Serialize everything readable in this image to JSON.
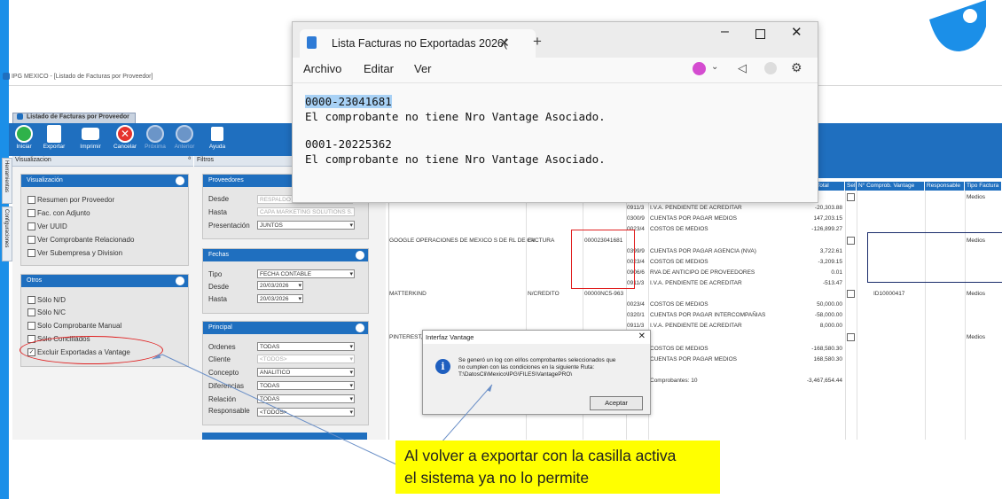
{
  "window_title": "IPG MEXICO - [Listado de Facturas por Proveedor]",
  "app_tab": "Listado de Facturas por Proveedor",
  "toolbar": {
    "iniciar": "Iniciar",
    "exportar": "Exportar",
    "imprimir": "Imprimir",
    "cancelar": "Cancelar",
    "proxima": "Próxima",
    "anterior": "Anterior",
    "ayuda": "Ayuda"
  },
  "subheader": {
    "visualizacion": "Visualizacion",
    "pin": "ª",
    "filtros": "Filtros"
  },
  "side_tabs": {
    "herramientas": "Herramientas",
    "configuraciones": "Configuraciones"
  },
  "visualizacion_panel": {
    "title": "Visualización",
    "items": [
      {
        "label": "Resumen por Proveedor",
        "checked": false
      },
      {
        "label": "Fac. con Adjunto",
        "checked": false
      },
      {
        "label": "Ver UUID",
        "checked": false
      },
      {
        "label": "Ver Comprobante Relacionado",
        "checked": false
      },
      {
        "label": "Ver Subempresa y Division",
        "checked": false
      }
    ]
  },
  "otros_panel": {
    "title": "Otros",
    "items": [
      {
        "label": "Sólo N/D",
        "checked": false
      },
      {
        "label": "Sólo N/C",
        "checked": false
      },
      {
        "label": "Solo Comprobante Manual",
        "checked": false
      },
      {
        "label": "Sólo Conciliados",
        "checked": false
      },
      {
        "label": "Excluir Exportadas a Vantage",
        "checked": true,
        "mark": "✓"
      }
    ]
  },
  "proveedores_panel": {
    "title": "Proveedores",
    "desde_label": "Desde",
    "desde_value": "RESPALDO F",
    "hasta_label": "Hasta",
    "hasta_value": "CAPA MARKETING SOLUTIONS S.",
    "presentacion_label": "Presentación",
    "presentacion_value": "JUNTOS"
  },
  "fechas_panel": {
    "title": "Fechas",
    "tipo_label": "Tipo",
    "tipo_value": "FECHA CONTABLE",
    "desde_label": "Desde",
    "desde_value": "20/03/2026",
    "hasta_label": "Hasta",
    "hasta_value": "20/03/2026"
  },
  "principal_panel": {
    "title": "Principal",
    "rows": [
      {
        "label": "Ordenes",
        "value": "TODAS",
        "disabled": false
      },
      {
        "label": "Cliente",
        "value": "<TODOS>",
        "disabled": true
      },
      {
        "label": "Concepto",
        "value": "ANALITICO",
        "disabled": false
      },
      {
        "label": "Diferencias",
        "value": "TODAS",
        "disabled": false
      },
      {
        "label": "Relación",
        "value": "TODAS",
        "disabled": false
      },
      {
        "label": "Responsable",
        "value": "<TODOS>",
        "disabled": false
      }
    ]
  },
  "grid": {
    "headers": {
      "total": "Total",
      "sel": "Sel",
      "comprob": "N° Comprob. Vantage",
      "responsable": "Responsable",
      "tipo": "Tipo Factura"
    },
    "rows": [
      {
        "proveedor": "",
        "tipo": "",
        "numero": "",
        "cuenta": "0911/3",
        "desc": "I.V.A. PENDIENTE DE ACREDITAR",
        "monto": "-20,303.88",
        "sel": false,
        "vantage": "",
        "tipofac": "Medios"
      },
      {
        "proveedor": "",
        "tipo": "",
        "numero": "",
        "cuenta": "0300/9",
        "desc": "CUENTAS POR PAGAR MEDIOS",
        "monto": "147,203.15"
      },
      {
        "proveedor": "",
        "tipo": "",
        "numero": "",
        "cuenta": "0023/4",
        "desc": "COSTOS DE MEDIOS",
        "monto": "-126,899.27"
      },
      {
        "proveedor": "GOOGLE OPERACIONES DE MEXICO S DE RL DE CV",
        "tipo": "FACTURA",
        "numero": "000023041681",
        "cuenta": "",
        "desc": "",
        "monto": "",
        "sel": false,
        "vantage": "",
        "tipofac": "Medios"
      },
      {
        "proveedor": "",
        "tipo": "",
        "numero": "",
        "cuenta": "0399/9",
        "desc": "CUENTAS POR PAGAR AGENCIA (NVA)",
        "monto": "3,722.61"
      },
      {
        "proveedor": "",
        "tipo": "",
        "numero": "",
        "cuenta": "0023/4",
        "desc": "COSTOS DE MEDIOS",
        "monto": "-3,209.15"
      },
      {
        "proveedor": "",
        "tipo": "",
        "numero": "",
        "cuenta": "0906/6",
        "desc": "RVA DE ANTICIPO DE PROVEEDORES",
        "monto": "0.01"
      },
      {
        "proveedor": "",
        "tipo": "",
        "numero": "",
        "cuenta": "0911/3",
        "desc": "I.V.A. PENDIENTE DE ACREDITAR",
        "monto": "-513.47"
      },
      {
        "proveedor": "MATTERKIND",
        "tipo": "N/CREDITO",
        "numero": "00000NC5-963",
        "cuenta": "",
        "desc": "",
        "monto": "",
        "sel": false,
        "vantage": "ID10000417",
        "tipofac": "Medios"
      },
      {
        "proveedor": "",
        "tipo": "",
        "numero": "",
        "cuenta": "0023/4",
        "desc": "COSTOS DE MEDIOS",
        "monto": "50,000.00"
      },
      {
        "proveedor": "",
        "tipo": "",
        "numero": "",
        "cuenta": "0320/1",
        "desc": "CUENTAS POR PAGAR INTERCOMPAÑIAS",
        "monto": "-58,000.00"
      },
      {
        "proveedor": "",
        "tipo": "",
        "numero": "",
        "cuenta": "0911/3",
        "desc": "I.V.A. PENDIENTE DE ACREDITAR",
        "monto": "8,000.00"
      },
      {
        "proveedor": "PINTEREST,",
        "tipo": "",
        "numero": "",
        "cuenta": "",
        "desc": "",
        "monto": "",
        "sel": false,
        "vantage": "",
        "tipofac": "Medios"
      },
      {
        "proveedor": "",
        "tipo": "",
        "numero": "",
        "cuenta": "",
        "desc": "COSTOS DE MEDIOS",
        "monto": "-168,580.30"
      },
      {
        "proveedor": "",
        "tipo": "",
        "numero": "",
        "cuenta": "",
        "desc": "CUENTAS POR PAGAR MEDIOS",
        "monto": "168,580.30"
      }
    ],
    "footer_label": "Comprobantes: 10",
    "footer_total": "-3,467,654.44"
  },
  "notepad": {
    "tab_title": "Lista Facturas no Exportadas 2026(",
    "menu": {
      "archivo": "Archivo",
      "editar": "Editar",
      "ver": "Ver"
    },
    "lines": [
      "0000-23041681",
      "El comprobante no tiene Nro Vantage Asociado.",
      "",
      "0001-20225362",
      "El comprobante no tiene Nro Vantage Asociado."
    ]
  },
  "dialog": {
    "title": "Interfaz Vantage",
    "message_line1": "Se generó un log con el/los comprobantes seleccionados que",
    "message_line2": "no cumplen con las condiciones en la siguiente Ruta:",
    "message_line3": "T:\\DatosCli\\Mexico\\IPG\\FILES\\VantagePRO\\",
    "button": "Aceptar"
  },
  "callout": {
    "line1": "Al volver a exportar con la casilla activa",
    "line2": "el sistema ya no lo permite"
  },
  "colors": {
    "toolbar": "#1f6fbf",
    "accent_bar": "#1b8fe8",
    "callout": "#ffff00",
    "highlight": "#e02020"
  }
}
